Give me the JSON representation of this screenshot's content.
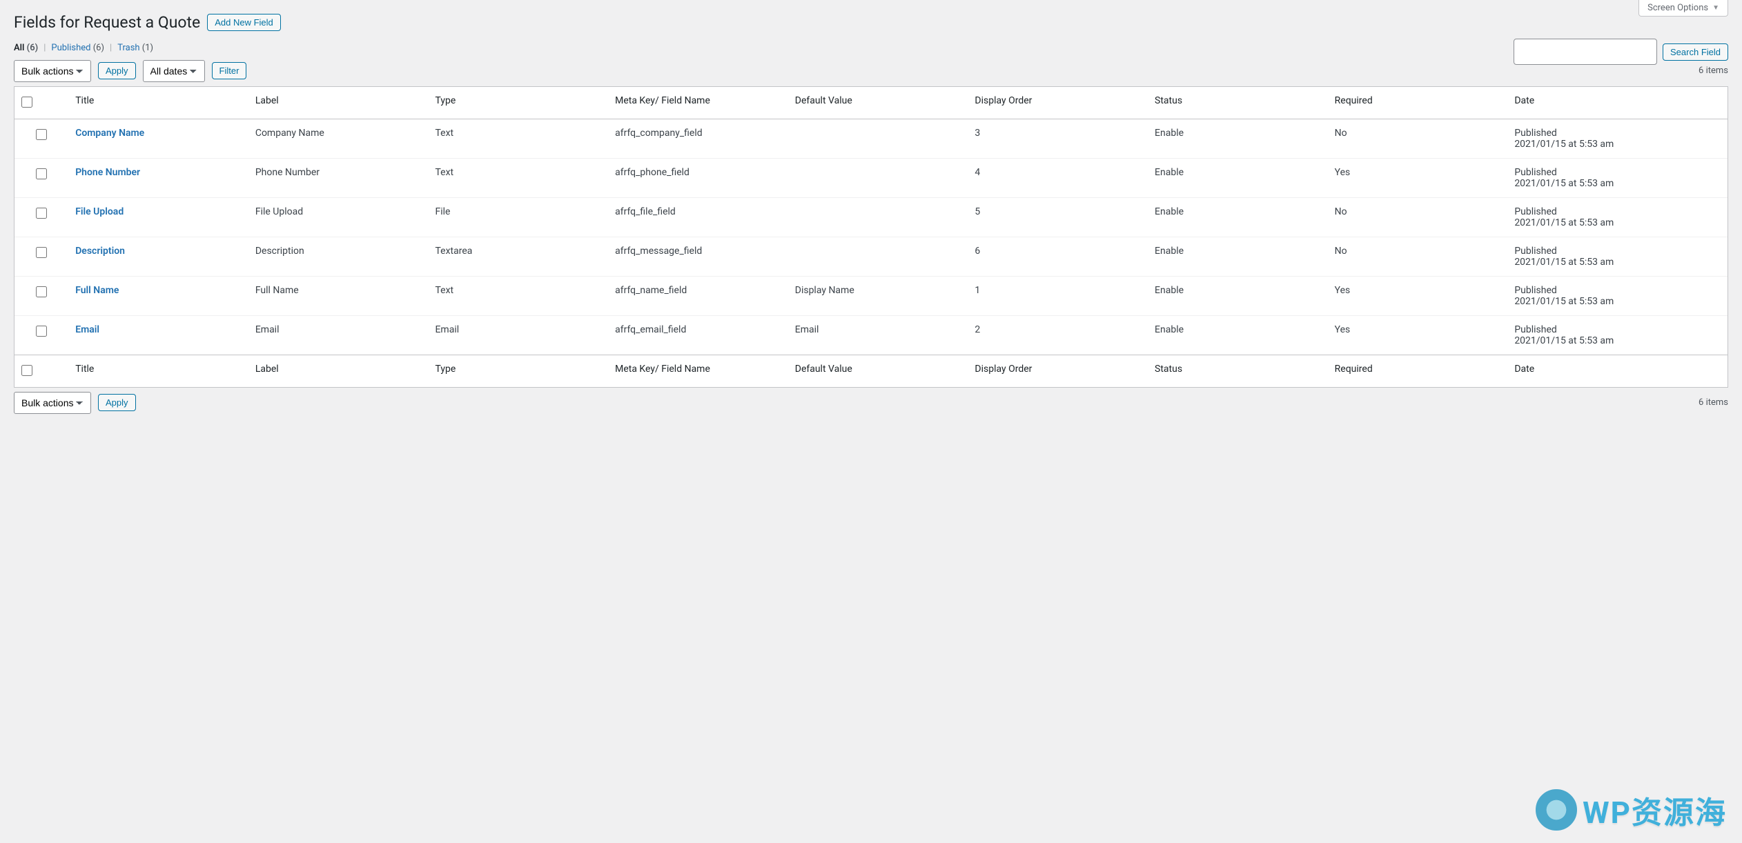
{
  "screenOptions": "Screen Options",
  "pageTitle": "Fields for Request a Quote",
  "addNewButton": "Add New Field",
  "views": {
    "all": {
      "label": "All",
      "count": "(6)"
    },
    "published": {
      "label": "Published",
      "count": "(6)"
    },
    "trash": {
      "label": "Trash",
      "count": "(1)"
    }
  },
  "search": {
    "button": "Search Field",
    "value": ""
  },
  "bulk": {
    "label": "Bulk actions",
    "apply": "Apply"
  },
  "dateFilter": {
    "label": "All dates",
    "filter": "Filter"
  },
  "itemCount": "6 items",
  "columns": {
    "title": "Title",
    "label": "Label",
    "type": "Type",
    "meta": "Meta Key/ Field Name",
    "default": "Default Value",
    "order": "Display Order",
    "status": "Status",
    "required": "Required",
    "date": "Date"
  },
  "rows": [
    {
      "title": "Company Name",
      "label": "Company Name",
      "type": "Text",
      "meta": "afrfq_company_field",
      "default": "",
      "order": "3",
      "status": "Enable",
      "required": "No",
      "date1": "Published",
      "date2": "2021/01/15 at 5:53 am"
    },
    {
      "title": "Phone Number",
      "label": "Phone Number",
      "type": "Text",
      "meta": "afrfq_phone_field",
      "default": "",
      "order": "4",
      "status": "Enable",
      "required": "Yes",
      "date1": "Published",
      "date2": "2021/01/15 at 5:53 am"
    },
    {
      "title": "File Upload",
      "label": "File Upload",
      "type": "File",
      "meta": "afrfq_file_field",
      "default": "",
      "order": "5",
      "status": "Enable",
      "required": "No",
      "date1": "Published",
      "date2": "2021/01/15 at 5:53 am"
    },
    {
      "title": "Description",
      "label": "Description",
      "type": "Textarea",
      "meta": "afrfq_message_field",
      "default": "",
      "order": "6",
      "status": "Enable",
      "required": "No",
      "date1": "Published",
      "date2": "2021/01/15 at 5:53 am"
    },
    {
      "title": "Full Name",
      "label": "Full Name",
      "type": "Text",
      "meta": "afrfq_name_field",
      "default": "Display Name",
      "order": "1",
      "status": "Enable",
      "required": "Yes",
      "date1": "Published",
      "date2": "2021/01/15 at 5:53 am"
    },
    {
      "title": "Email",
      "label": "Email",
      "type": "Email",
      "meta": "afrfq_email_field",
      "default": "Email",
      "order": "2",
      "status": "Enable",
      "required": "Yes",
      "date1": "Published",
      "date2": "2021/01/15 at 5:53 am"
    }
  ],
  "watermark": "WP资源海"
}
